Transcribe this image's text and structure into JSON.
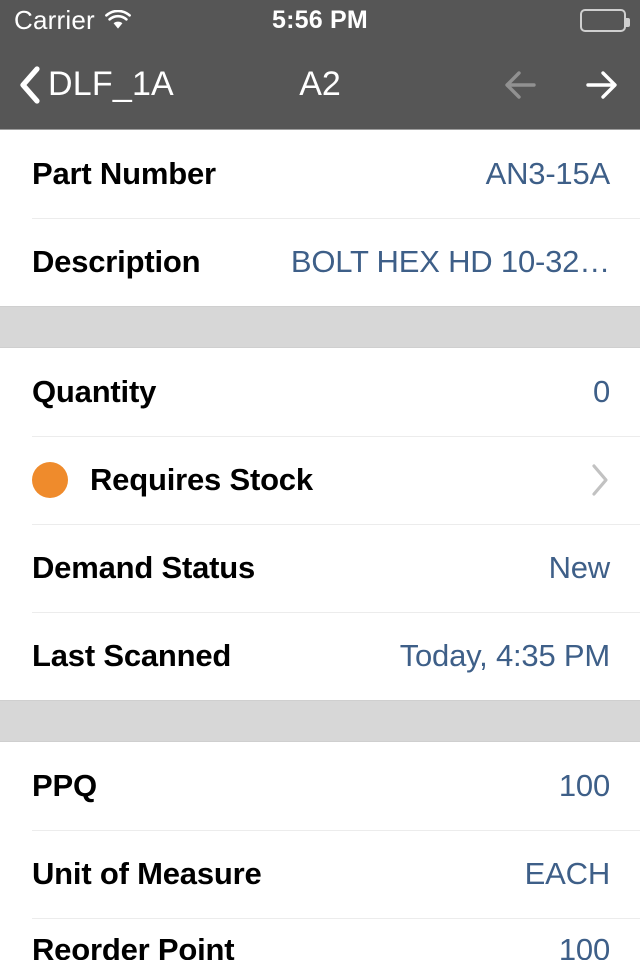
{
  "status_bar": {
    "carrier": "Carrier",
    "wifi_icon": "wifi-icon",
    "time": "5:56 PM",
    "battery_icon": "battery-full-icon"
  },
  "nav_bar": {
    "back_icon": "chevron-left-icon",
    "back_label": "DLF_1A",
    "title": "A2",
    "prev_icon": "arrow-left-icon",
    "next_icon": "arrow-right-icon",
    "prev_enabled": false,
    "next_enabled": true
  },
  "colors": {
    "chrome": "#565656",
    "value_text": "#3e5f88",
    "status_dot_orange": "#ef8b2c",
    "section_gap": "#d7d7d7",
    "separator": "#ececec",
    "disclosure": "#c2c2c2"
  },
  "sections": [
    {
      "rows": [
        {
          "label": "Part Number",
          "value": "AN3-15A"
        },
        {
          "label": "Description",
          "value": "BOLT HEX HD 10-32…"
        }
      ]
    },
    {
      "rows": [
        {
          "label": "Quantity",
          "value": "0"
        },
        {
          "label": "Requires Stock",
          "value": "",
          "dot": "status-dot-orange",
          "disclosure": "chevron-right-icon"
        },
        {
          "label": "Demand Status",
          "value": "New"
        },
        {
          "label": "Last Scanned",
          "value": "Today, 4:35 PM"
        }
      ]
    },
    {
      "rows": [
        {
          "label": "PPQ",
          "value": "100"
        },
        {
          "label": "Unit of Measure",
          "value": "EACH"
        },
        {
          "label": "Reorder Point",
          "value": "100"
        }
      ]
    }
  ]
}
